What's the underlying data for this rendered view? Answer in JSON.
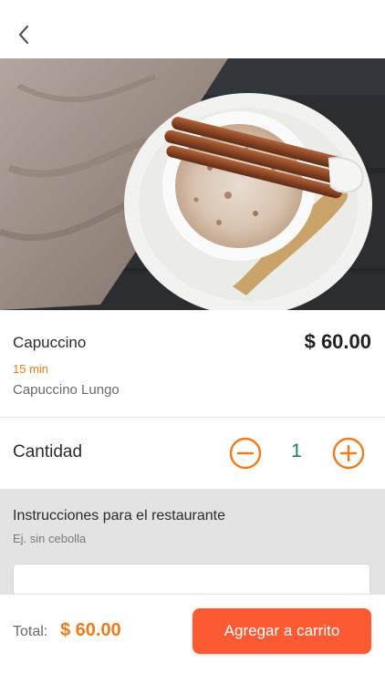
{
  "header": {
    "back_icon": "chevron-left-icon"
  },
  "hero": {
    "image_subject": "cappuccino-with-cinnamon-sticks"
  },
  "product": {
    "name": "Capuccino",
    "price": "$ 60.00",
    "prep_time": "15 min",
    "description": "Capuccino Lungo"
  },
  "quantity": {
    "label": "Cantidad",
    "value": "1",
    "decrement_icon": "minus-circle-icon",
    "increment_icon": "plus-circle-icon"
  },
  "instructions": {
    "title": "Instrucciones para el restaurante",
    "hint": "Ej. sin cebolla",
    "input_value": ""
  },
  "footer": {
    "total_label": "Total:",
    "total_value": "$ 60.00",
    "add_button_label": "Agregar a carrito"
  },
  "colors": {
    "accent_orange": "#f07b1c",
    "button_orange": "#fb5a33",
    "quantity_teal": "#1f7a6e",
    "instructions_bg": "#e3e3e3"
  }
}
